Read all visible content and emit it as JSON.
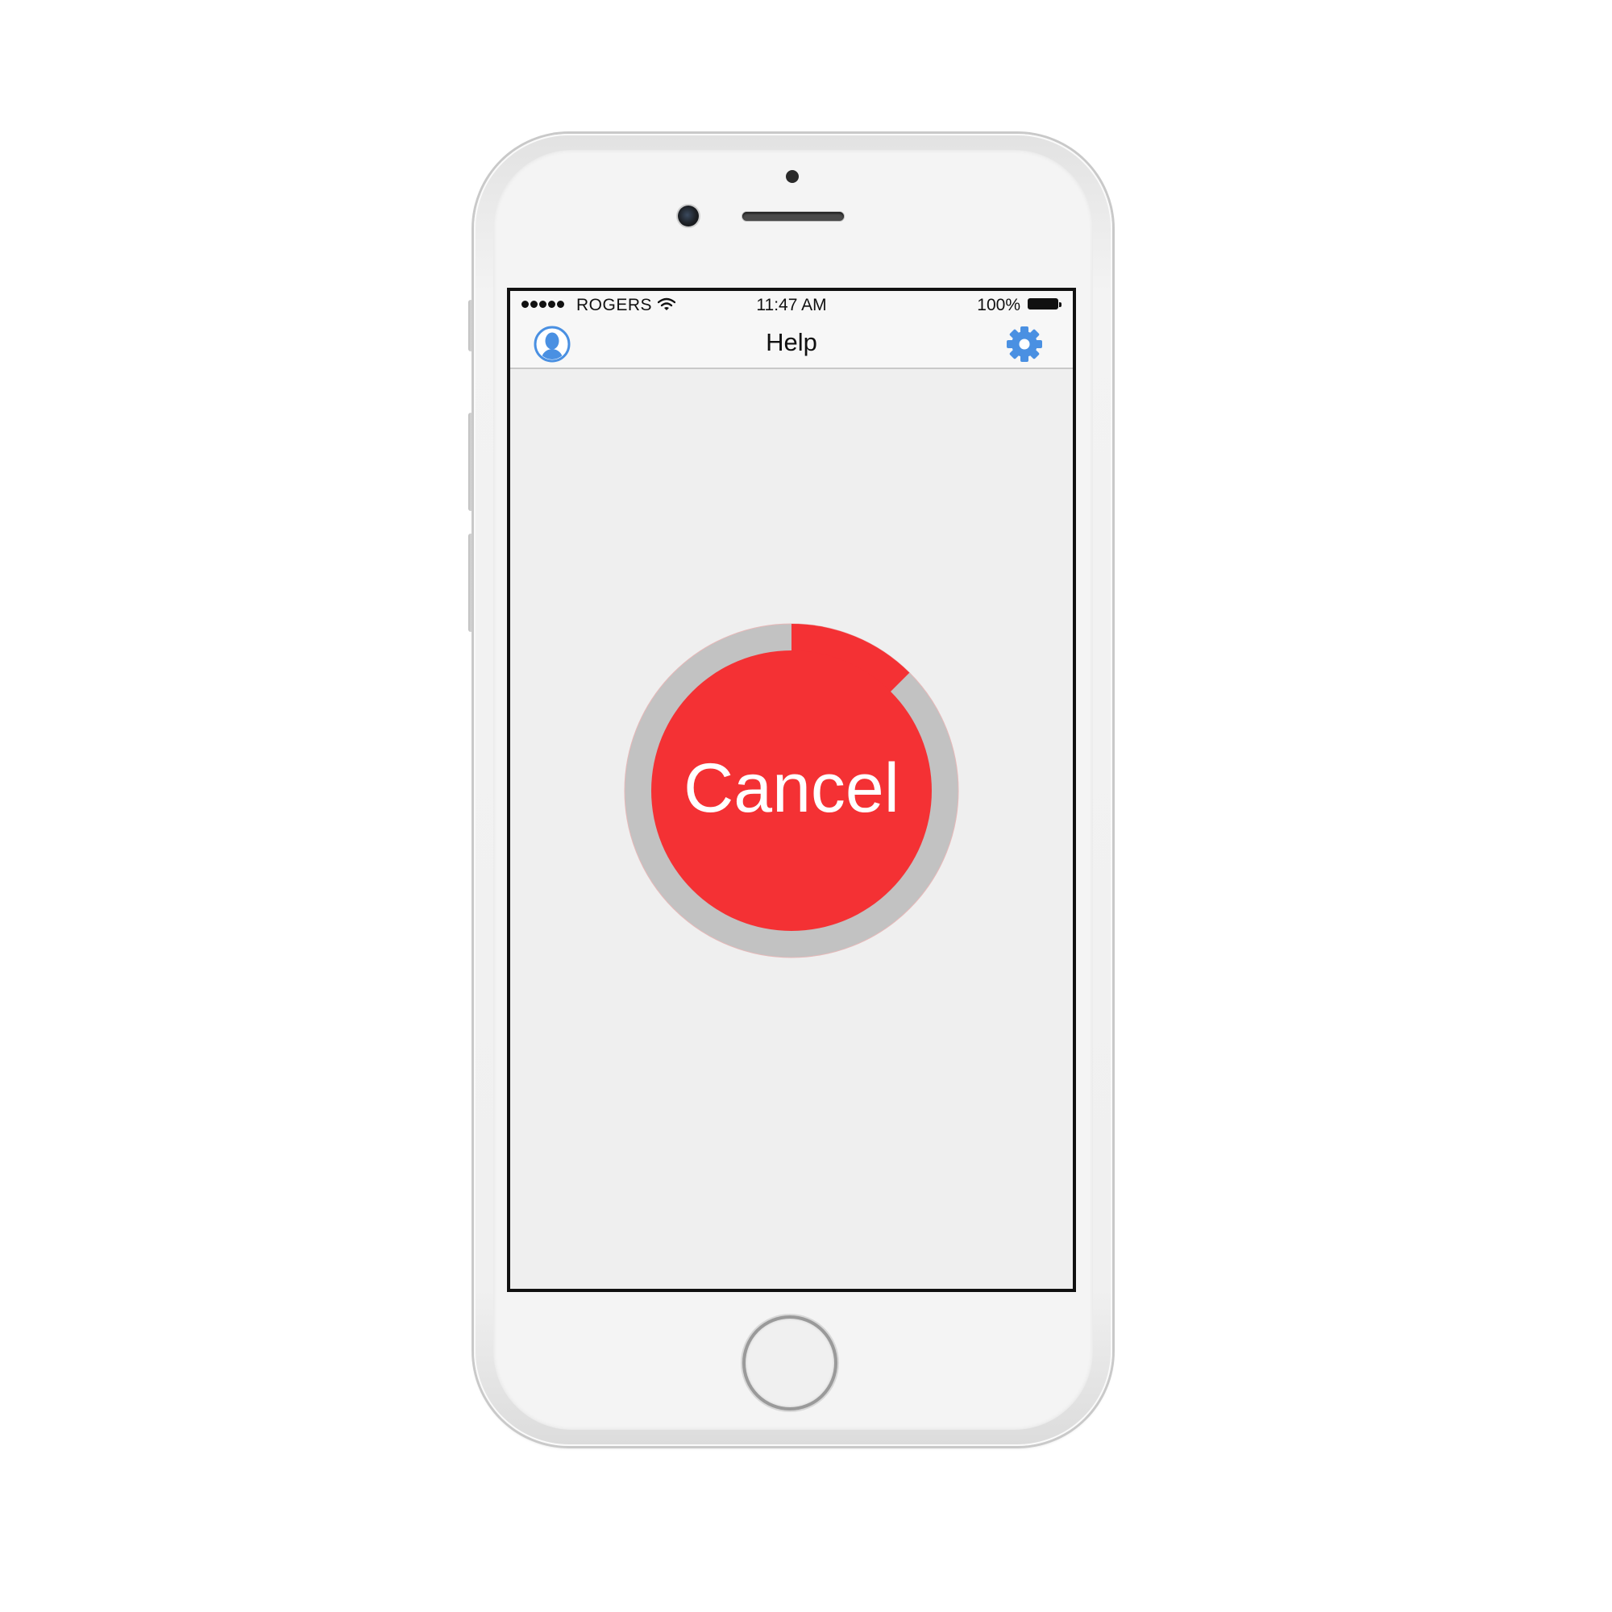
{
  "status_bar": {
    "carrier": "ROGERS",
    "time": "11:47 AM",
    "battery": "100%"
  },
  "nav": {
    "title": "Help",
    "left_icon": "profile-icon",
    "right_icon": "gear-icon"
  },
  "cancel_button": {
    "label": "Cancel",
    "progress_fraction": 0.125
  },
  "colors": {
    "accent_blue": "#4a90e2",
    "cancel_red": "#f43134",
    "ring_gray": "#c2c2c2",
    "screen_background": "#efefef"
  }
}
